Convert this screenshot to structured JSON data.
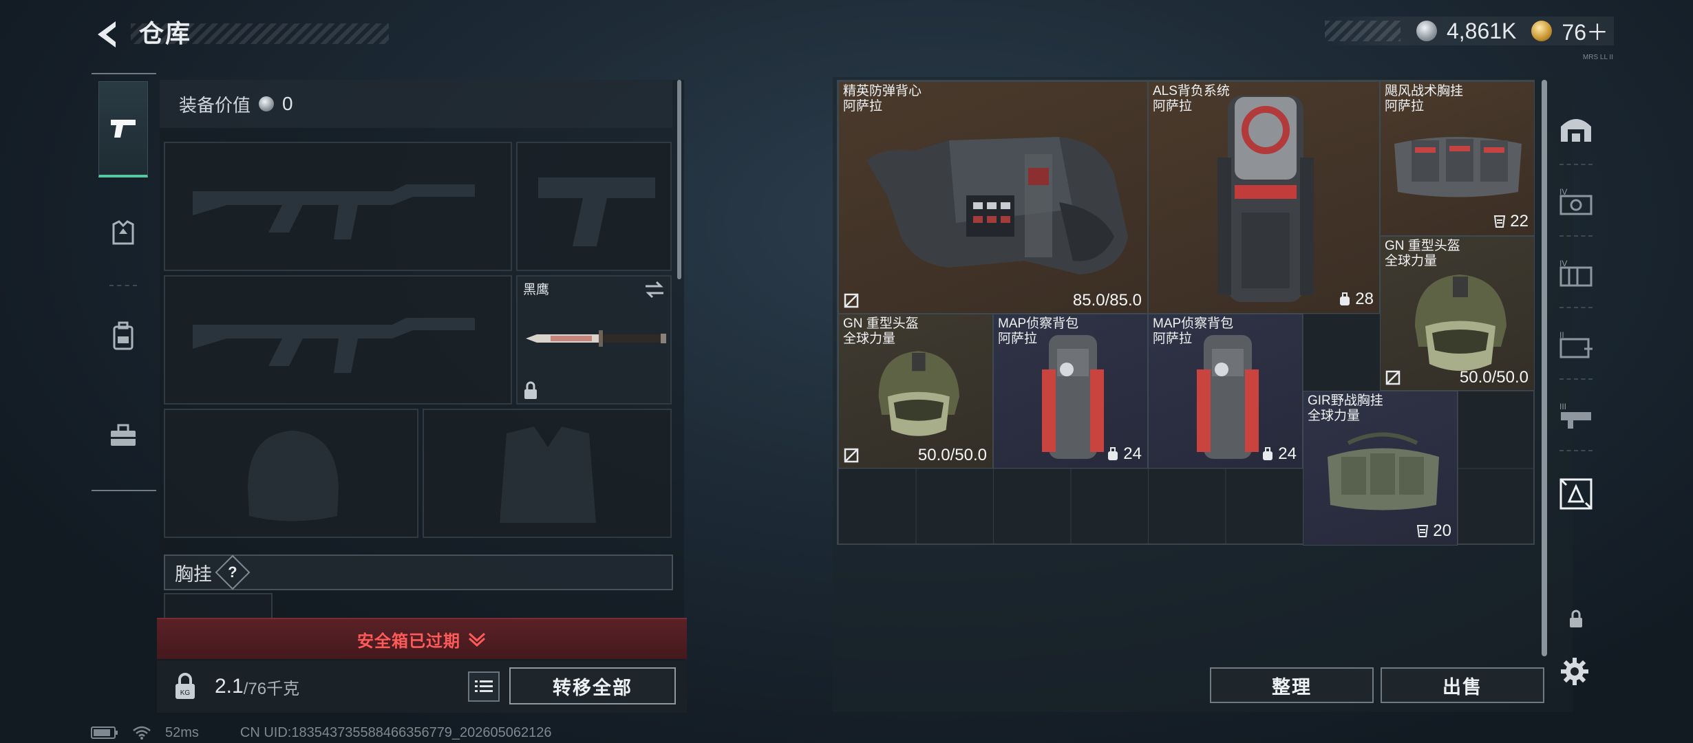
{
  "header": {
    "title": "仓库",
    "currency": [
      {
        "icon": "silver-coin-icon",
        "value": "4,861K"
      },
      {
        "icon": "gold-coin-icon",
        "value": "76＋"
      }
    ],
    "tiny_label": "MRS LL II"
  },
  "left_tabs": [
    {
      "name": "weapons",
      "icon": "pistol-icon",
      "active": true
    },
    {
      "name": "armor",
      "icon": "armor-vest-icon",
      "active": false
    },
    {
      "name": "backpack",
      "icon": "backpack-icon",
      "active": false
    },
    {
      "name": "toolbox",
      "icon": "toolbox-icon",
      "active": false
    }
  ],
  "equipment": {
    "value_label": "装备价值",
    "value": "0",
    "knife_name": "黑鹰",
    "chest_rig_label": "胸挂",
    "chest_rig_help": "?"
  },
  "safebox": {
    "text": "安全箱已过期"
  },
  "bottom": {
    "weight_current": "2.1",
    "weight_max": "/76千克",
    "transfer_all": "转移全部"
  },
  "status": {
    "ping": "52ms",
    "uid": "CN UID:1835437355884663567​79_202605062126"
  },
  "storage": {
    "items": [
      {
        "name": "精英防弹背心",
        "sub": "阿萨拉",
        "stat": "85.0/85.0",
        "icon": "body-armor-icon",
        "color": "brown"
      },
      {
        "name": "ALS背负系统",
        "sub": "阿萨拉",
        "stat": "28",
        "icon": "hiking-backpack-icon",
        "color": "brown"
      },
      {
        "name": "飓风战术胸挂",
        "sub": "阿萨拉",
        "stat": "22",
        "icon": "chest-rig-icon",
        "color": "brown"
      },
      {
        "name": "GN 重型头盔",
        "sub": "全球力量",
        "stat": "50.0/50.0",
        "icon": "helmet-icon",
        "color": "olive"
      },
      {
        "name": "GN 重型头盔",
        "sub": "全球力量",
        "stat": "50.0/50.0",
        "icon": "helmet-icon",
        "color": "olive"
      },
      {
        "name": "MAP侦察背包",
        "sub": "阿萨拉",
        "stat": "24",
        "icon": "scout-backpack-icon",
        "color": "navy"
      },
      {
        "name": "MAP侦察背包",
        "sub": "阿萨拉",
        "stat": "24",
        "icon": "scout-backpack-icon",
        "color": "navy"
      },
      {
        "name": "GIR野战胸挂",
        "sub": "全球力量",
        "stat": "20",
        "icon": "field-chest-rig-icon",
        "color": "navy"
      }
    ]
  },
  "actions": {
    "sort": "整理",
    "sell": "出售"
  },
  "right_tabs": [
    "storage-tab-1",
    "storage-tab-2",
    "storage-tab-3",
    "storage-tab-4",
    "storage-tab-5",
    "storage-tab-6"
  ]
}
